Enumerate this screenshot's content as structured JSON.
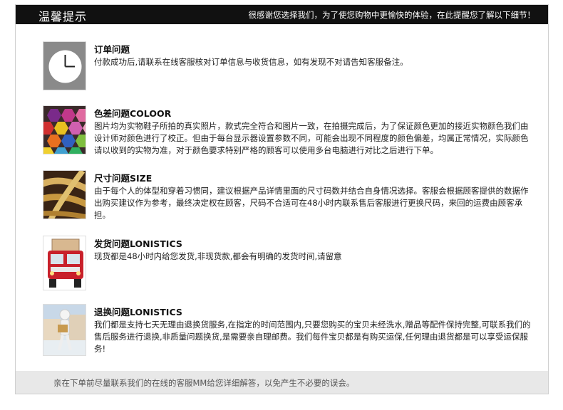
{
  "header": {
    "title": "温馨提示",
    "note": "很感谢您选择我们，为了使您购物中更愉快的体验，在此提醒您了解以下细节！"
  },
  "sections": [
    {
      "icon": "clock-icon",
      "title": "订单问题",
      "body": "付款成功后,请联系在线客服核对订单信息与收货信息，如有发现不对请告知客服备注。"
    },
    {
      "icon": "color-swatches-icon",
      "title": "色差问题COLOOR",
      "body": "图片均为实物鞋子所拍的真实照片，款式完全符合和图片一致，在拍摄完成后，为了保证颜色更加的接近实物颜色我们由设计师对颜色进行了校正。但由于每台显示器设置参数不同，可能会出现不同程度的颜色偏差，均属正常情况，实际颜色请以收到的实物为准，对于颜色要求特别严格的顾客可以使用多台电脑进行对比之后进行下单。"
    },
    {
      "icon": "measuring-tape-icon",
      "title": "尺寸问题SIZE",
      "body": "由于每个人的体型和穿着习惯同，建议根据产品详情里面的尺寸码数并结合自身情况选择。客服会根据顾客提供的数据作出购买建议作为参考，最终决定权在顾客，尺码不合适可在48小时内联系售后客服进行更换尺码，来回的运费由顾客承担。"
    },
    {
      "icon": "delivery-truck-icon",
      "title": "发货问题LONISTICS",
      "body": "现货都是48小时内给您发货,非现货款,都会有明确的发货时间,请留意"
    },
    {
      "icon": "return-box-person-icon",
      "title": "退换问题LONISTICS",
      "body": "我们都是支持七天无理由退换货服务,在指定的时间范围内,只要您购买的宝贝未经洗水,赠品等配件保持完整,可联系我们的售后服务进行退换,非质量问题换货,是需要亲自理邮费。我们每件宝贝都是有购买运保,任何理由退货都是可以享受运保服务!"
    }
  ],
  "footer": {
    "text": "亲在下单前尽量联系我们的在线的客服MM给您详细解答，以免产生不必要的误会。"
  },
  "colors": {
    "header_bg": "#111111",
    "footer_bg": "#e8e8e8",
    "border": "#cfcfcf"
  }
}
